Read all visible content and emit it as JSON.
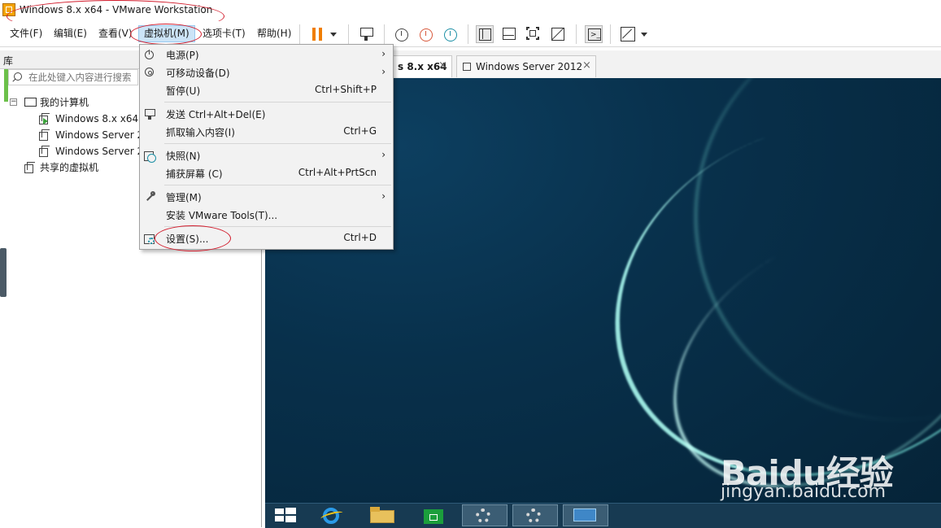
{
  "window": {
    "title": "Windows 8.x x64 - VMware Workstation"
  },
  "menubar": {
    "file": "文件(F)",
    "edit": "编辑(E)",
    "view": "查看(V)",
    "vm": "虚拟机(M)",
    "tabs": "选项卡(T)",
    "help": "帮助(H)"
  },
  "toolbar": {
    "icons": [
      "pause-icon",
      "dropdown-icon",
      "send-cad-icon",
      "snapshot-icon",
      "revert-snapshot-icon",
      "snapshot-manager-icon",
      "library-view-icon",
      "thumbnail-view-icon",
      "fullscreen-icon",
      "unity-icon",
      "console-icon",
      "stretch-icon"
    ]
  },
  "library": {
    "title": "库",
    "search_placeholder": "在此处键入内容进行搜索",
    "tree": {
      "my_computer": "我的计算机",
      "vm1": "Windows 8.x x64",
      "vm2": "Windows Server 2",
      "vm3": "Windows Server 2",
      "shared": "共享的虚拟机"
    }
  },
  "tabs": {
    "tab1": "s 8.x x64",
    "tab2": "Windows Server 2012",
    "close": "×"
  },
  "vm_menu": {
    "power": "电源(P)",
    "removable": "可移动设备(D)",
    "pause": "暂停(U)",
    "pause_shortcut": "Ctrl+Shift+P",
    "send_cad": "发送 Ctrl+Alt+Del(E)",
    "grab_input": "抓取输入内容(I)",
    "grab_shortcut": "Ctrl+G",
    "snapshot": "快照(N)",
    "capture": "捕获屏幕 (C)",
    "capture_shortcut": "Ctrl+Alt+PrtScn",
    "manage": "管理(M)",
    "install_tools": "安装 VMware Tools(T)...",
    "settings": "设置(S)...",
    "settings_shortcut": "Ctrl+D",
    "arrow": "›"
  },
  "watermark": {
    "line1": "Baidu经验",
    "line2": "jingyan.baidu.com"
  },
  "colors": {
    "accent": "#f07d00",
    "vm_bg": "#08304b",
    "annotation": "#d21c2c",
    "menu_highlight": "#cce4f7"
  }
}
